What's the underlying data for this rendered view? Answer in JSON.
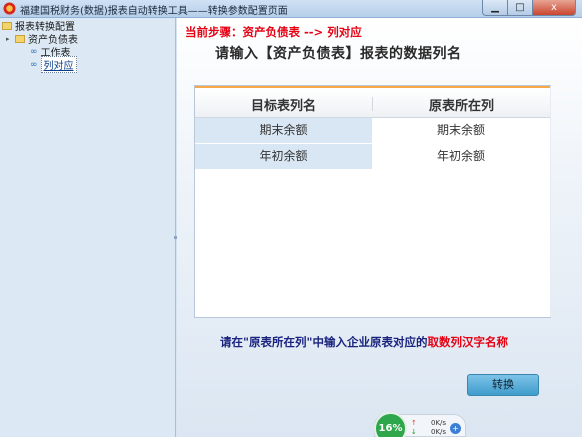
{
  "window": {
    "title": "福建国税财务(数据)报表自动转换工具——转换参数配置页面",
    "minimize_icon": "minimize-icon",
    "maximize_icon": "maximize-icon",
    "close_icon": "close-icon",
    "close_label": "x"
  },
  "tree": {
    "root": "报表转换配置",
    "node": "资产负债表",
    "children": [
      "工作表",
      "列对应"
    ],
    "selected": "列对应"
  },
  "main": {
    "step": "当前步骤：资产负债表 --> 列对应",
    "heading": "请输入【资产负债表】报表的数据列名",
    "columns": [
      "目标表列名",
      "原表所在列"
    ],
    "rows": [
      [
        "期末余额",
        "期末余额"
      ],
      [
        "年初余额",
        "年初余额"
      ]
    ],
    "hint_prefix": "请在\"原表所在列\"中输入企业原表对应的",
    "hint_highlight": "取数列汉字名称",
    "convert_button": "转换"
  },
  "widget": {
    "percent": "16%",
    "up_speed": "0K/s",
    "down_speed": "0K/s",
    "up_arrow": "↑",
    "down_arrow": "↓",
    "bubble": "+"
  },
  "colors": {
    "step_text": "#e60012",
    "hint_text": "#1a237e",
    "header_accent": "#f7a64a",
    "button": "#4fa8d4"
  }
}
